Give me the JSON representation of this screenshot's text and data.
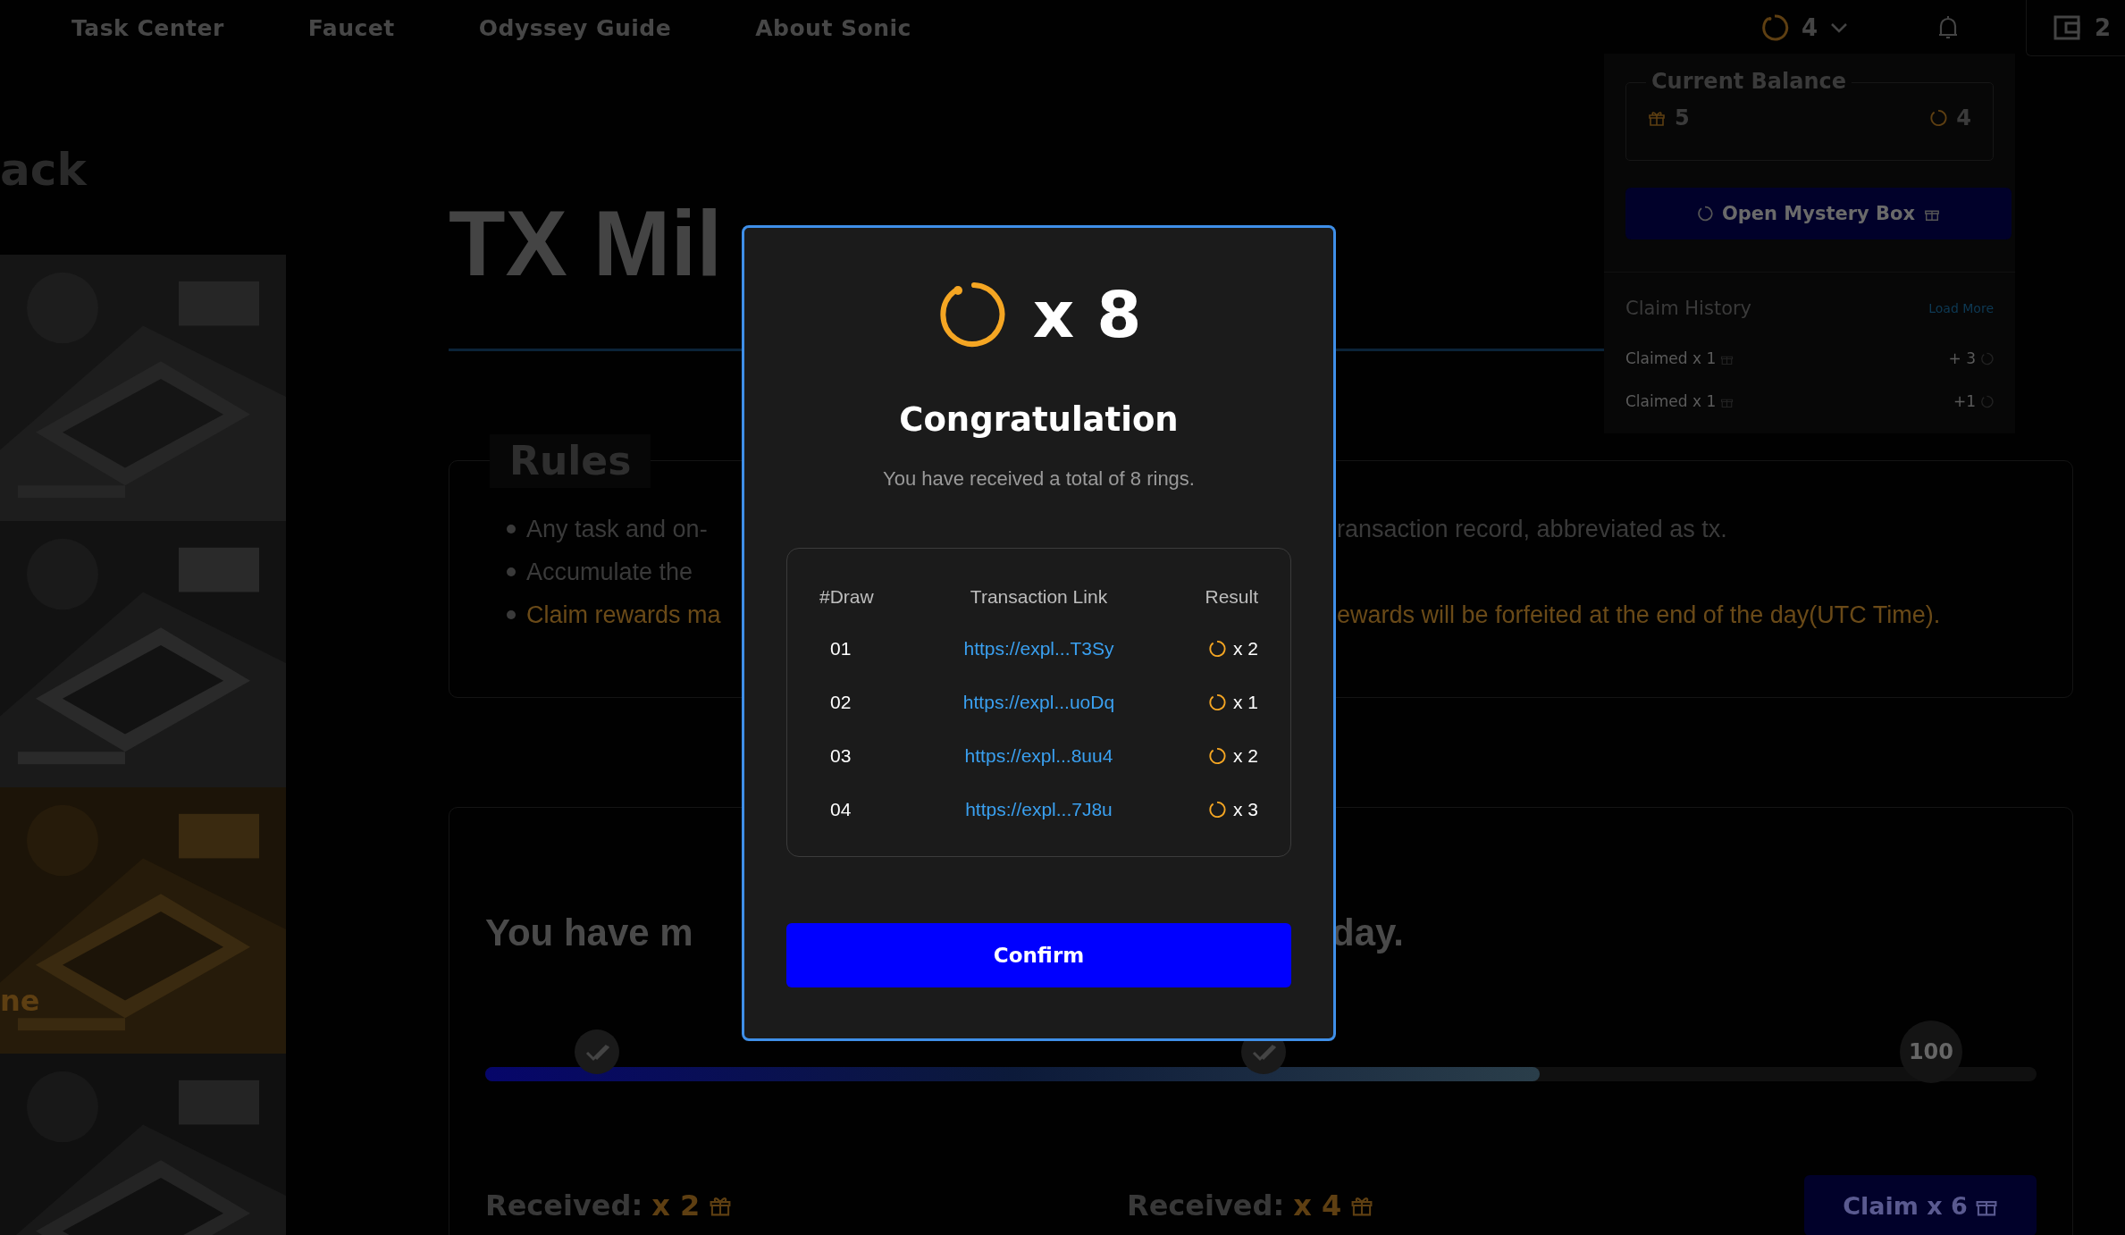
{
  "nav": {
    "items": [
      "Task Center",
      "Faucet",
      "Odyssey Guide",
      "About Sonic"
    ],
    "rings": "4",
    "wallet": "2"
  },
  "balance_panel": {
    "title": "Current Balance",
    "gifts": "5",
    "rings": "4",
    "open_button": "Open Mystery Box",
    "history_title": "Claim History",
    "load_more": "Load More",
    "history": [
      {
        "label": "Claimed x 1",
        "amount": "+ 3"
      },
      {
        "label": "Claimed x 1",
        "amount": "+1"
      }
    ]
  },
  "side": {
    "back": "ack",
    "tile_caption": "ne"
  },
  "page": {
    "title": "TX Mil",
    "rules": {
      "title": "Rules",
      "items": [
        {
          "left": "Any task and on-",
          "right": "ransaction record, abbreviated as tx.",
          "highlight": false
        },
        {
          "left": "Accumulate the",
          "highlight": false
        },
        {
          "left": "Claim rewards ma",
          "right": "ewards will be forfeited at the end of the day(UTC Time).",
          "highlight": true
        }
      ]
    },
    "progress": {
      "heading_left": "You have m",
      "heading_right": "day.",
      "level": 0.68,
      "milestones": [
        {
          "kind": "check"
        },
        {
          "kind": "check"
        },
        {
          "kind": "label",
          "label": "100"
        }
      ],
      "received": [
        {
          "label": "Received:",
          "amount": "x 2"
        },
        {
          "label": "Received:",
          "amount": "x 4"
        }
      ],
      "claim_button": "Claim x 6"
    }
  },
  "dialog": {
    "count": "x 8",
    "title": "Congratulation",
    "message": "You have received a total of 8 rings.",
    "columns": [
      "#Draw",
      "Transaction Link",
      "Result"
    ],
    "rows": [
      {
        "draw": "01",
        "link": "https://expl...T3Sy",
        "result": "x 2"
      },
      {
        "draw": "02",
        "link": "https://expl...uoDq",
        "result": "x 1"
      },
      {
        "draw": "03",
        "link": "https://expl...8uu4",
        "result": "x 2"
      },
      {
        "draw": "04",
        "link": "https://expl...7J8u",
        "result": "x 3"
      }
    ],
    "confirm": "Confirm"
  }
}
